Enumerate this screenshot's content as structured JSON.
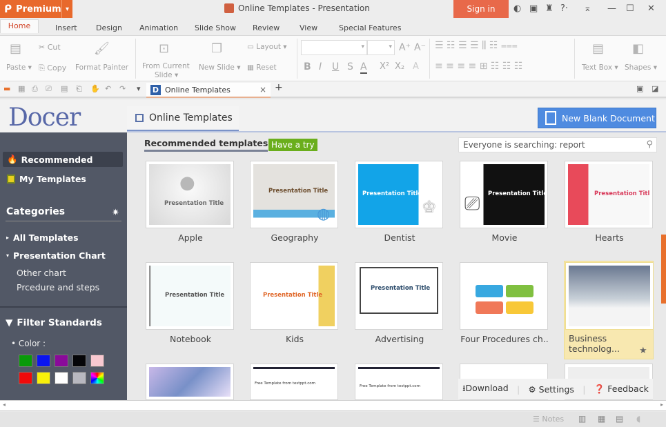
{
  "titlebar": {
    "premium_label": "Premium",
    "window_title": "Online Templates - Presentation",
    "signin_label": "Sign in",
    "icons": [
      "skin-icon",
      "mail-icon",
      "shirt-icon",
      "help-icon",
      "collapse-ribbon-icon",
      "minimize-icon",
      "maximize-icon",
      "close-icon"
    ],
    "help_label": "?"
  },
  "menu": {
    "tabs": [
      "Home",
      "Insert",
      "Design",
      "Animation",
      "Slide Show",
      "Review",
      "View",
      "Special Features"
    ],
    "active": "Home"
  },
  "ribbon": {
    "paste": "Paste",
    "cut": "Cut",
    "copy": "Copy",
    "format_painter": "Format Painter",
    "from_current_slide_1": "From Current",
    "from_current_slide_2": "Slide",
    "new_slide": "New Slide",
    "layout": "Layout",
    "reset": "Reset",
    "font_name": "",
    "font_size": "",
    "bold": "B",
    "italic": "I",
    "underline": "U",
    "strike": "S",
    "font_color": "A",
    "superscript": "X²",
    "subscript": "X₂",
    "grow": "A⁺",
    "shrink": "A⁻",
    "clear": "A",
    "text_box": "Text Box",
    "shapes": "Shapes"
  },
  "doc_tab": {
    "label": "Online Templates",
    "close": "×",
    "new_tab": "+"
  },
  "docer": {
    "logo": "Docer",
    "tab_label": "Online Templates",
    "new_blank": "New Blank Document"
  },
  "sidebar": {
    "recommended": "Recommended",
    "my_templates": "My Templates",
    "categories_title": "Categories",
    "all_templates": "All Templates",
    "presentation_chart": "Presentation Chart",
    "subitems": [
      "Other chart",
      "Prcedure and steps"
    ],
    "filter_title": "Filter Standards",
    "color_label": "Color :",
    "colors": [
      "#0a9a0a",
      "#0a14f0",
      "#8a0a9a",
      "#050508",
      "#f8c8d0",
      "#f00a0a",
      "#f8f00a",
      "#ffffff",
      "#b8b8c0",
      "rainbow"
    ]
  },
  "main": {
    "recommended_title": "Recommended templates",
    "have_a_try": "Have a try",
    "search_placeholder": "Everyone is searching: report",
    "thumb_title": "Presentation Title",
    "templates": [
      {
        "name": "Apple"
      },
      {
        "name": "Geography"
      },
      {
        "name": "Dentist"
      },
      {
        "name": "Movie"
      },
      {
        "name": "Hearts"
      },
      {
        "name": "Notebook"
      },
      {
        "name": "Kids"
      },
      {
        "name": "Advertising"
      },
      {
        "name": "Four Procedures ch.."
      },
      {
        "name": "Business technolog..."
      }
    ],
    "row3_text": "Free Template from testppt.com"
  },
  "actions": {
    "download": "Download",
    "settings": "Settings",
    "feedback": "Feedback"
  },
  "status": {
    "notes": "Notes"
  }
}
